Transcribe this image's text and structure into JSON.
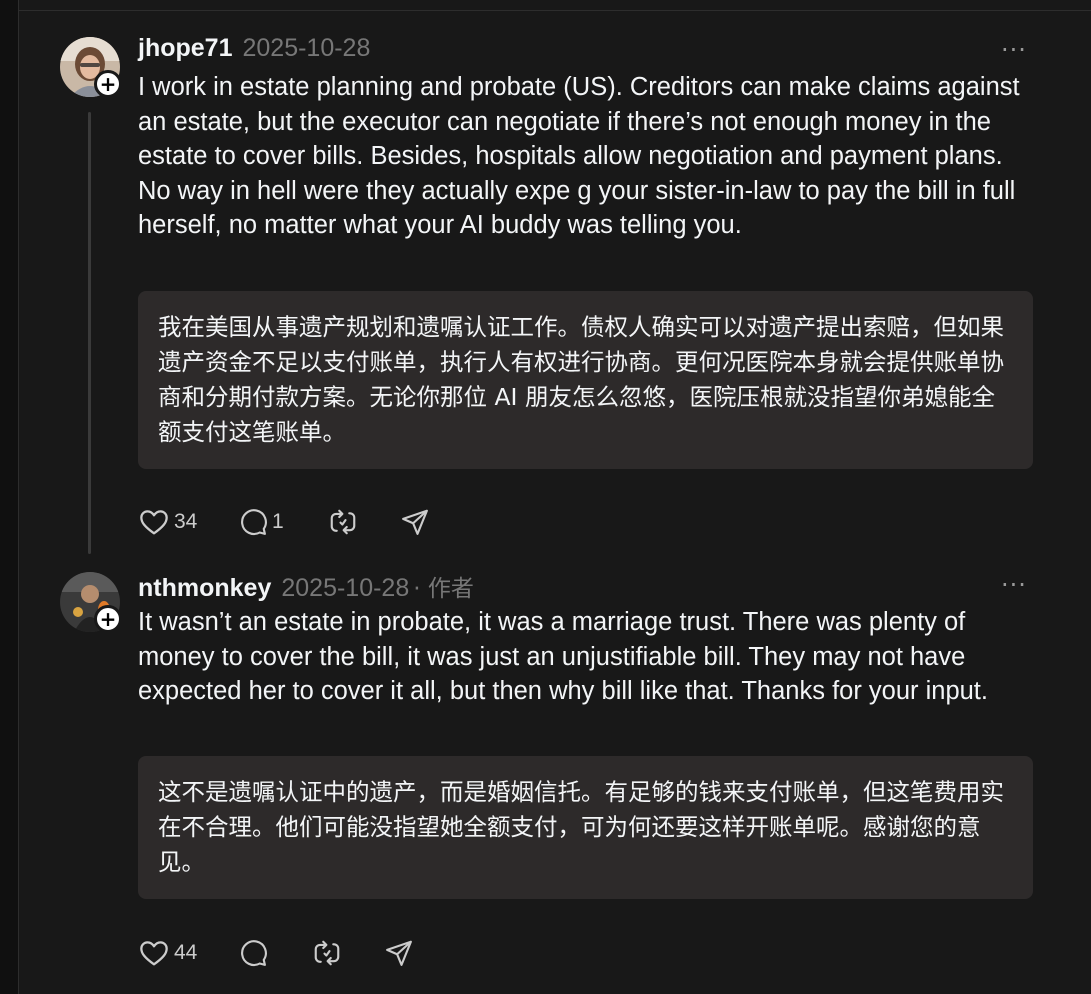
{
  "comments": [
    {
      "username": "jhope71",
      "date": "2025-10-28",
      "author_tag": "",
      "avatar_icon": "profile-photo",
      "body": "I work in estate planning and probate (US). Creditors can make claims against an estate, but the executor can negotiate if there’s not enough money in the estate to cover bills. Besides, hospitals allow negotiation and payment plans. No way in hell were they actually expe   g your sister-in-law to pay the bill in full herself, no matter what your AI buddy was telling you.",
      "translation": "我在美国从事遗产规划和遗嘱认证工作。债权人确实可以对遗产提出索赔，但如果遗产资金不足以支付账单，执行人有权进行协商。更何况医院本身就会提供账单协商和分期付款方案。无论你那位 AI 朋友怎么忽悠，医院压根就没指望你弟媳能全额支付这笔账单。",
      "likes": "34",
      "replies": "1",
      "more_label": "···"
    },
    {
      "username": "nthmonkey",
      "date": "2025-10-28",
      "author_tag": "· 作者",
      "avatar_icon": "profile-photo",
      "body": "It wasn’t an estate in probate, it was a marriage trust. There was plenty of money to cover the bill, it was just an unjustifiable bill. They may not have expected her to cover it all, but then why bill like that. Thanks for your input.",
      "translation": "这不是遗嘱认证中的遗产，而是婚姻信托。有足够的钱来支付账单，但这笔费用实在不合理。他们可能没指望她全额支付，可为何还要这样开账单呢。感谢您的意见。",
      "likes": "44",
      "replies": "",
      "more_label": "···"
    }
  ],
  "follow_badge": "+",
  "colors": {
    "background": "#181818",
    "text": "#f3f5f7",
    "muted": "#777777",
    "translation_bg": "#2d2a2a"
  }
}
